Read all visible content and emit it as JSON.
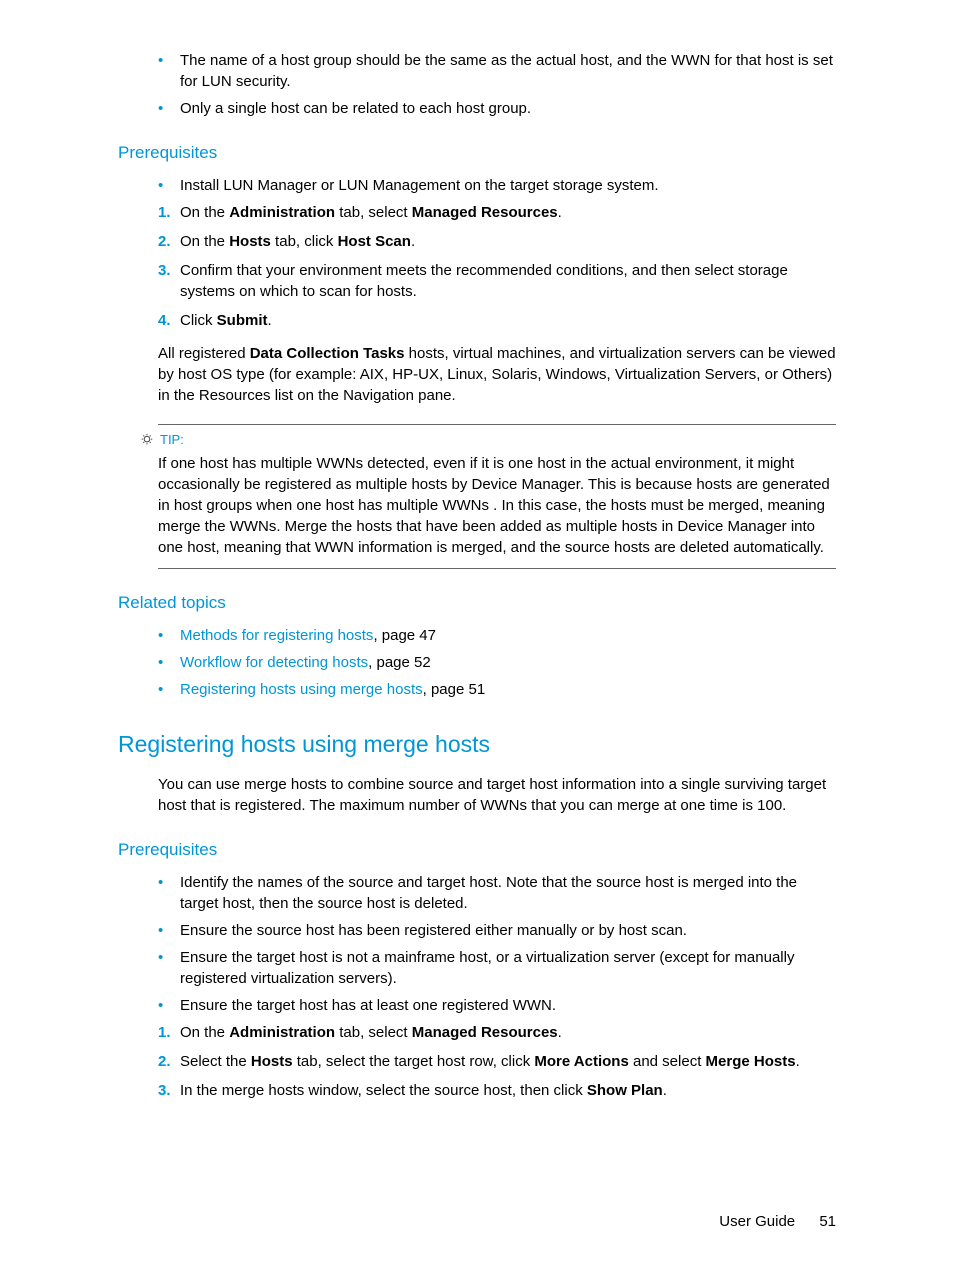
{
  "top_bullets": [
    "The name of a host group should be the same as the actual host, and the WWN for that host is set for LUN security.",
    "Only a single host can be related to each host group."
  ],
  "sec1": {
    "heading": "Prerequisites",
    "bullet": "Install LUN Manager or LUN Management on the target storage system.",
    "steps": {
      "s1_a": "On the ",
      "s1_b": "Administration",
      "s1_c": " tab, select ",
      "s1_d": "Managed Resources",
      "s1_e": ".",
      "s2_a": "On the ",
      "s2_b": "Hosts",
      "s2_c": " tab, click ",
      "s2_d": "Host Scan",
      "s2_e": ".",
      "s3": "Confirm that your environment meets the recommended conditions, and then select storage systems on which to scan for hosts.",
      "s4_a": "Click ",
      "s4_b": "Submit",
      "s4_c": "."
    },
    "para_a": "All registered ",
    "para_b": "Data Collection Tasks",
    "para_c": " hosts, virtual machines, and virtualization servers can be viewed by host OS type (for example: AIX, HP-UX, Linux, Solaris, Windows, Virtualization Servers, or Others) in the Resources list on the Navigation pane."
  },
  "tip": {
    "label": "TIP:",
    "body": "If one host has multiple WWNs detected, even if it is one host in the actual environment, it might occasionally be registered as multiple hosts by Device Manager. This is because hosts are generated in host groups when one host has multiple WWNs . In this case, the hosts must be merged, meaning merge the WWNs. Merge the hosts that have been added as multiple hosts in Device Manager into one host, meaning that WWN information is merged, and the source hosts are deleted automatically."
  },
  "related": {
    "heading": "Related topics",
    "items": [
      {
        "link": "Methods for registering hosts",
        "suffix": ", page 47"
      },
      {
        "link": "Workflow for detecting hosts",
        "suffix": ", page 52"
      },
      {
        "link": "Registering hosts using merge hosts",
        "suffix": ", page 51"
      }
    ]
  },
  "sec2": {
    "heading": "Registering hosts using merge hosts",
    "intro": "You can use merge hosts to combine source and target host information into a single surviving target host that is registered. The maximum number of WWNs that you can merge at one time is 100.",
    "sub": "Prerequisites",
    "bullets": [
      "Identify the names of the source and target host. Note that the source host is merged into the target host, then the source host is deleted.",
      "Ensure the source host has been registered either manually or by host scan.",
      "Ensure the target host is not a mainframe host, or a virtualization server (except for manually registered virtualization servers).",
      "Ensure the target host has at least one registered WWN."
    ],
    "steps": {
      "s1_a": "On the ",
      "s1_b": "Administration",
      "s1_c": " tab, select ",
      "s1_d": "Managed Resources",
      "s1_e": ".",
      "s2_a": "Select the ",
      "s2_b": "Hosts",
      "s2_c": " tab, select the target host row, click ",
      "s2_d": "More Actions",
      "s2_e": " and select ",
      "s2_f": "Merge Hosts",
      "s2_g": ".",
      "s3_a": "In the merge hosts window, select the source host, then click ",
      "s3_b": "Show Plan",
      "s3_c": "."
    }
  },
  "footer": {
    "title": "User Guide",
    "page": "51"
  }
}
